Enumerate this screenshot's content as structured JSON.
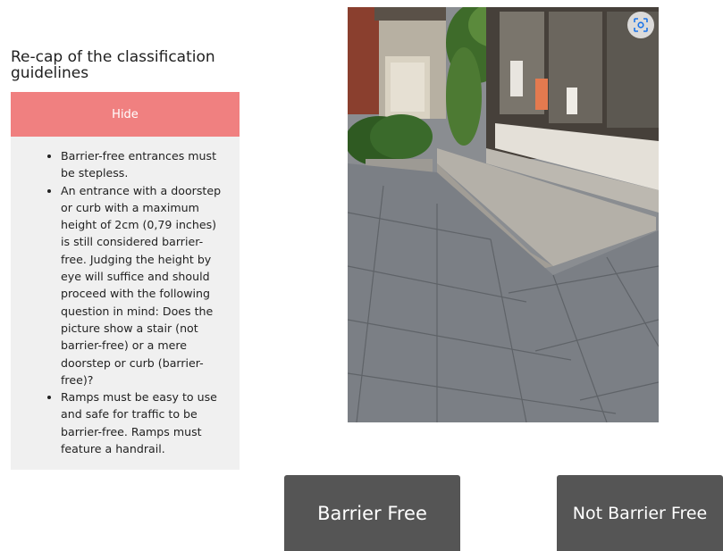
{
  "panel": {
    "title": "Re-cap of the classification guidelines",
    "hide_label": "Hide",
    "guidelines": [
      "Barrier-free entrances must be stepless.",
      "An entrance with a doorstep or curb with a maximum height of 2cm (0,79 inches) is still considered barrier-free. Judging the height by eye will suffice and should proceed with the following question in mind: Does the picture show a stair (not barrier-free) or a mere doorstep or curb (barrier-free)?",
      "Ramps must be easy to use and safe for traffic to be barrier-free. Ramps must feature a handrail."
    ]
  },
  "photo": {
    "lens_icon": "lens-search-icon"
  },
  "choices": {
    "barrier_free_label": "Barrier Free",
    "not_barrier_free_label": "Not Barrier Free"
  },
  "colors": {
    "hide_button": "#f08080",
    "guide_background": "#f0f0f0",
    "choice_button": "#555555"
  }
}
